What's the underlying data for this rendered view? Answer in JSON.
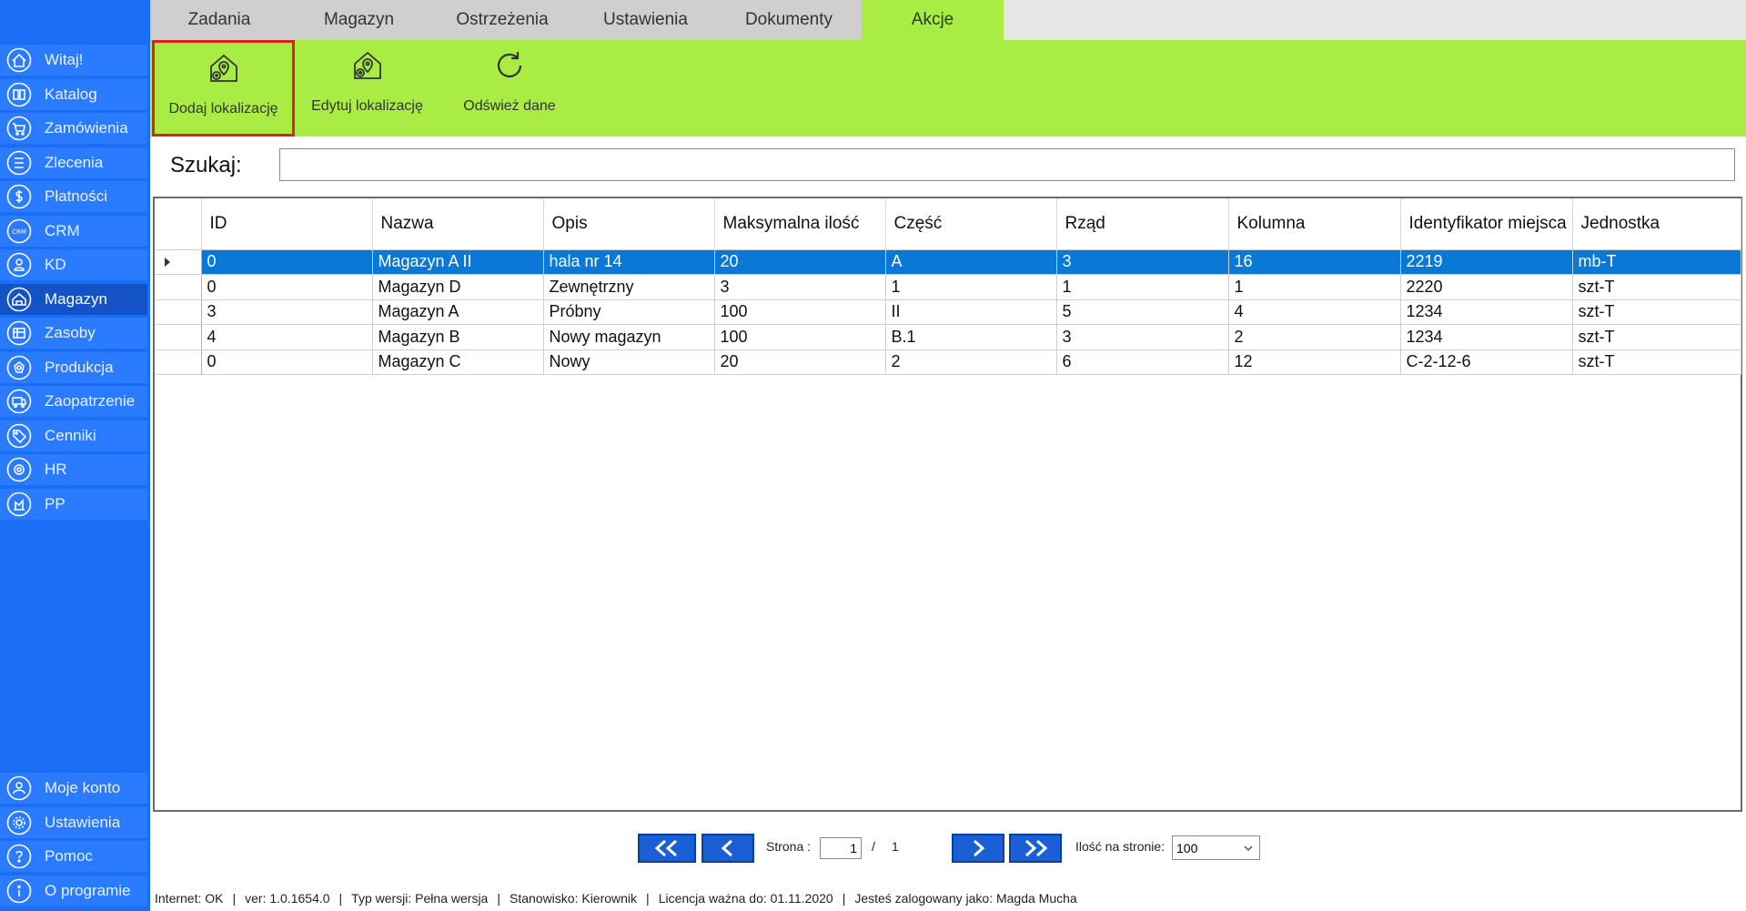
{
  "sidebar": {
    "items": [
      {
        "label": "Witaj!",
        "icon": "home-icon"
      },
      {
        "label": "Katalog",
        "icon": "book-icon"
      },
      {
        "label": "Zamówienia",
        "icon": "cart-icon"
      },
      {
        "label": "Zlecenia",
        "icon": "list-icon"
      },
      {
        "label": "Płatności",
        "icon": "dollar-icon"
      },
      {
        "label": "CRM",
        "icon": "crm-icon"
      },
      {
        "label": "KD",
        "icon": "user-lock-icon"
      },
      {
        "label": "Magazyn",
        "icon": "warehouse-icon"
      },
      {
        "label": "Zasoby",
        "icon": "resources-icon"
      },
      {
        "label": "Produkcja",
        "icon": "production-icon"
      },
      {
        "label": "Zaopatrzenie",
        "icon": "truck-icon"
      },
      {
        "label": "Cenniki",
        "icon": "tag-icon"
      },
      {
        "label": "HR",
        "icon": "hr-icon"
      },
      {
        "label": "PP",
        "icon": "pp-icon"
      }
    ],
    "bottom_items": [
      {
        "label": "Moje konto",
        "icon": "user-icon"
      },
      {
        "label": "Ustawienia",
        "icon": "gear-icon"
      },
      {
        "label": "Pomoc",
        "icon": "help-icon"
      },
      {
        "label": "O programie",
        "icon": "info-icon"
      }
    ]
  },
  "tabs": [
    {
      "label": "Zadania"
    },
    {
      "label": "Magazyn"
    },
    {
      "label": "Ostrzeżenia"
    },
    {
      "label": "Ustawienia"
    },
    {
      "label": "Dokumenty"
    },
    {
      "label": "Akcje"
    }
  ],
  "ribbon": {
    "add_location": "Dodaj lokalizację",
    "edit_location": "Edytuj lokalizację",
    "refresh": "Odśwież dane"
  },
  "search": {
    "label": "Szukaj:",
    "value": ""
  },
  "grid": {
    "columns": [
      "ID",
      "Nazwa",
      "Opis",
      "Maksymalna ilość",
      "Część",
      "Rząd",
      "Kolumna",
      "Identyfikator miejsca",
      "Jednostka"
    ],
    "rows": [
      [
        "0",
        "Magazyn A II",
        "hala nr 14",
        "20",
        "A",
        "3",
        "16",
        "2219",
        "mb-T"
      ],
      [
        "0",
        "Magazyn D",
        "Zewnętrzny",
        "3",
        "1",
        "1",
        "1",
        "2220",
        "szt-T"
      ],
      [
        "3",
        "Magazyn A",
        "Próbny",
        "100",
        "II",
        "5",
        "4",
        "1234",
        "szt-T"
      ],
      [
        "4",
        "Magazyn B",
        "Nowy magazyn",
        "100",
        "B.1",
        "3",
        "2",
        "1234",
        "szt-T"
      ],
      [
        "0",
        "Magazyn C",
        "Nowy",
        "20",
        "2",
        "6",
        "12",
        "C-2-12-6",
        "szt-T"
      ]
    ]
  },
  "pagination": {
    "page_label": "Strona :",
    "current_page": "1",
    "separator": "/",
    "total_pages": "1",
    "per_page_label": "Ilość na stronie:",
    "per_page_value": "100"
  },
  "status": {
    "internet": "Internet: OK",
    "version": "ver: 1.0.1654.0",
    "type": "Typ wersji: Pełna wersja",
    "position": "Stanowisko: Kierownik",
    "license": "Licencja ważna do: 01.11.2020",
    "user": "Jesteś zalogowany jako: Magda Mucha"
  },
  "colors": {
    "sidebar": "#1a6ef5",
    "sidebar_item": "#2a7bff",
    "sidebar_active": "#1452c8",
    "accent_green": "#a8ec44",
    "selection_blue": "#0a78d7",
    "highlight_red": "#e02020"
  }
}
